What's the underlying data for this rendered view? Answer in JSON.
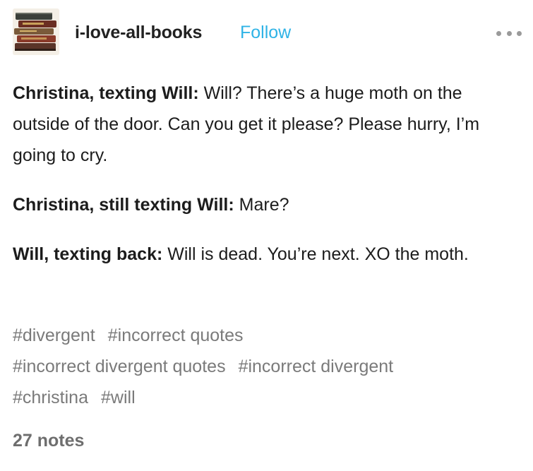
{
  "blog": {
    "name": "i-love-all-books",
    "follow_label": "Follow",
    "avatar_icon": "stacked-books-icon"
  },
  "post": {
    "paragraphs": [
      {
        "speaker": "Christina, texting Will:",
        "text": " Will? There’s a huge moth on the outside of the door. Can you get it please? Please hurry, I’m going to cry."
      },
      {
        "speaker": "Christina, still texting Will:",
        "text": " Mare?"
      },
      {
        "speaker": "Will, texting back:",
        "text": " Will is dead. You’re next. XO the moth."
      }
    ],
    "tags": [
      "#divergent",
      "#incorrect quotes",
      "#incorrect divergent quotes",
      "#incorrect divergent",
      "#christina",
      "#will"
    ],
    "notes": "27 notes"
  },
  "colors": {
    "follow": "#2fb3e6",
    "tag": "#7a7a7a",
    "notes": "#6e6e6e",
    "text": "#1c1c1c"
  }
}
